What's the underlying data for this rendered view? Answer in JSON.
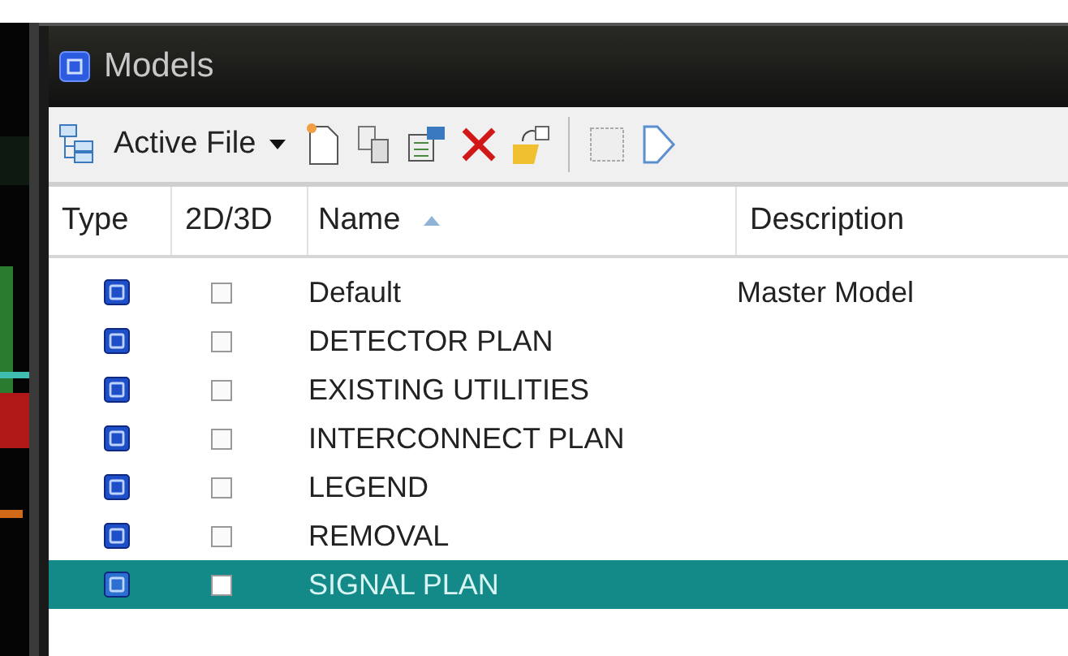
{
  "window": {
    "title": "Models"
  },
  "toolbar": {
    "source": "Active File"
  },
  "table": {
    "columns": [
      "Type",
      "2D/3D",
      "Name",
      "Description"
    ],
    "rows": [
      {
        "name": "Default",
        "description": "Master Model",
        "selected": false
      },
      {
        "name": "DETECTOR PLAN",
        "selected": false
      },
      {
        "name": "EXISTING UTILITIES",
        "selected": false
      },
      {
        "name": "INTERCONNECT PLAN",
        "selected": false
      },
      {
        "name": "LEGEND",
        "selected": false
      },
      {
        "name": "REMOVAL",
        "selected": false
      },
      {
        "name": "SIGNAL PLAN",
        "selected": true
      }
    ]
  }
}
